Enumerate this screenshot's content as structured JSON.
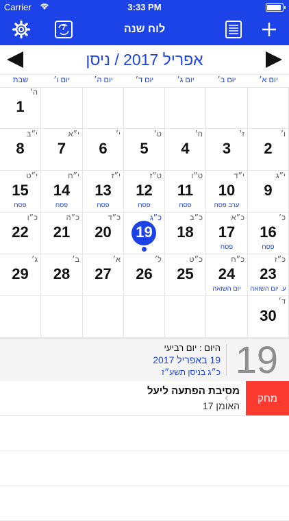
{
  "status": {
    "carrier": "Carrier",
    "time": "3:33 PM"
  },
  "nav": {
    "title": "לוח שנה",
    "today_badge": "7"
  },
  "month": {
    "title": "אפריל 2017 / ניסן"
  },
  "weekdays": [
    "יום א׳",
    "יום ב׳",
    "יום ג׳",
    "יום ד׳",
    "יום ה׳",
    "יום ו׳",
    "שבת"
  ],
  "weeks": [
    [
      {
        "n": "",
        "h": ""
      },
      {
        "n": "",
        "h": ""
      },
      {
        "n": "",
        "h": ""
      },
      {
        "n": "",
        "h": ""
      },
      {
        "n": "",
        "h": ""
      },
      {
        "n": "",
        "h": ""
      },
      {
        "n": "1",
        "h": "ה׳"
      }
    ],
    [
      {
        "n": "2",
        "h": "ו׳"
      },
      {
        "n": "3",
        "h": "ז׳"
      },
      {
        "n": "4",
        "h": "ח׳"
      },
      {
        "n": "5",
        "h": "ט׳"
      },
      {
        "n": "6",
        "h": "י׳"
      },
      {
        "n": "7",
        "h": "י״א"
      },
      {
        "n": "8",
        "h": "י״ב"
      }
    ],
    [
      {
        "n": "9",
        "h": "י״ג"
      },
      {
        "n": "10",
        "h": "י״ד",
        "e": "ערב פסח"
      },
      {
        "n": "11",
        "h": "ט״ו",
        "e": "פסח"
      },
      {
        "n": "12",
        "h": "ט״ז",
        "e": "פסח"
      },
      {
        "n": "13",
        "h": "י״ז",
        "e": "פסח"
      },
      {
        "n": "14",
        "h": "י״ח",
        "e": "פסח"
      },
      {
        "n": "15",
        "h": "י״ט",
        "e": "פסח"
      }
    ],
    [
      {
        "n": "16",
        "h": "כ׳",
        "e": "פסח"
      },
      {
        "n": "17",
        "h": "כ״א",
        "e": "פסח"
      },
      {
        "n": "18",
        "h": "כ״ב"
      },
      {
        "n": "19",
        "h": "כ״ג",
        "today": true
      },
      {
        "n": "20",
        "h": "כ״ד"
      },
      {
        "n": "21",
        "h": "כ״ה"
      },
      {
        "n": "22",
        "h": "כ״ו"
      }
    ],
    [
      {
        "n": "23",
        "h": "כ״ז",
        "e": "ע. יום השואה"
      },
      {
        "n": "24",
        "h": "כ״ח",
        "e": "יום השואה"
      },
      {
        "n": "25",
        "h": "כ״ט"
      },
      {
        "n": "26",
        "h": "ל׳"
      },
      {
        "n": "27",
        "h": "א׳"
      },
      {
        "n": "28",
        "h": "ב׳"
      },
      {
        "n": "29",
        "h": "ג׳"
      }
    ],
    [
      {
        "n": "30",
        "h": "ד׳"
      },
      {
        "n": "",
        "h": ""
      },
      {
        "n": "",
        "h": ""
      },
      {
        "n": "",
        "h": ""
      },
      {
        "n": "",
        "h": ""
      },
      {
        "n": "",
        "h": ""
      },
      {
        "n": "",
        "h": ""
      }
    ]
  ],
  "info": {
    "big_day": "19",
    "line1": "היום : יום רביעי",
    "line2": "19 באפריל 2017",
    "line3": "כ״ג בניסן תשע״ז"
  },
  "event": {
    "title": "מסיבת הפתעה ליעל",
    "subtitle": "האומן 17",
    "delete_label": "מחק"
  },
  "colors": {
    "brand": "#1b43e8",
    "delete": "#fc3a30"
  }
}
